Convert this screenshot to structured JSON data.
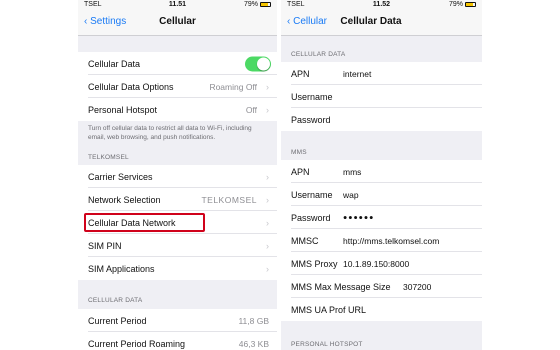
{
  "left": {
    "status": {
      "carrier": "TSEL",
      "time": "11.51",
      "battery": "79%"
    },
    "nav": {
      "back": "Settings",
      "title": "Cellular"
    },
    "rows1": [
      {
        "label": "Cellular Data",
        "toggle_on": true
      },
      {
        "label": "Cellular Data Options",
        "value": "Roaming Off"
      },
      {
        "label": "Personal Hotspot",
        "value": "Off"
      }
    ],
    "footer_text": "Turn off cellular data to restrict all data to Wi-Fi, including email, web browsing, and push notifications.",
    "section_carrier": "TELKOMSEL",
    "rows2": [
      {
        "label": "Carrier Services",
        "value": ""
      },
      {
        "label": "Network Selection",
        "value": "TELKOMSEL"
      },
      {
        "label": "Cellular Data Network",
        "value": ""
      },
      {
        "label": "SIM PIN",
        "value": ""
      },
      {
        "label": "SIM Applications",
        "value": ""
      }
    ],
    "section_cellular_data": "CELLULAR DATA",
    "rows3": [
      {
        "label": "Current Period",
        "value": "11,8 GB"
      },
      {
        "label": "Current Period Roaming",
        "value": "46,3 KB"
      }
    ]
  },
  "right": {
    "status": {
      "carrier": "TSEL",
      "time": "11.52",
      "battery": "79%"
    },
    "nav": {
      "back": "Cellular",
      "title": "Cellular Data"
    },
    "section1": "CELLULAR DATA",
    "rows1": [
      {
        "label": "APN",
        "value": "internet"
      },
      {
        "label": "Username",
        "value": ""
      },
      {
        "label": "Password",
        "value": ""
      }
    ],
    "section2": "MMS",
    "rows2": [
      {
        "label": "APN",
        "value": "mms"
      },
      {
        "label": "Username",
        "value": "wap"
      },
      {
        "label": "Password",
        "value": "●●●●●●"
      },
      {
        "label": "MMSC",
        "value": "http://mms.telkomsel.com"
      },
      {
        "label": "MMS Proxy",
        "value": "10.1.89.150:8000"
      },
      {
        "label": "MMS Max Message Size",
        "value": "307200"
      },
      {
        "label": "MMS UA Prof URL",
        "value": ""
      }
    ],
    "section3": "PERSONAL HOTSPOT"
  },
  "colors": {
    "accent": "#1a7bf5",
    "toggle_on": "#4cd964",
    "highlight": "#d0021b"
  }
}
